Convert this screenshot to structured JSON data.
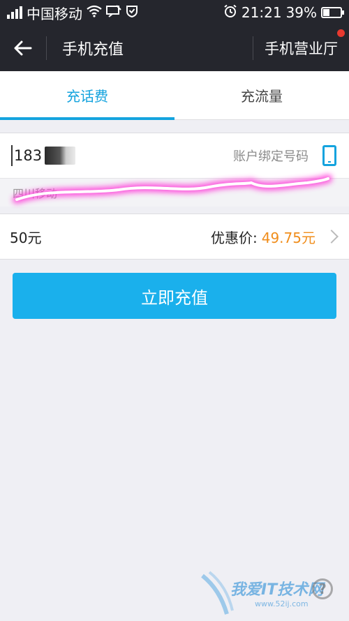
{
  "status_bar": {
    "carrier": "中国移动",
    "time": "21:21",
    "battery": "39%",
    "battery_level": 0.39
  },
  "nav": {
    "title": "手机充值",
    "right_link": "手机营业厅"
  },
  "tabs": [
    {
      "label": "充话费",
      "active": true
    },
    {
      "label": "充流量",
      "active": false
    }
  ],
  "phone": {
    "number_prefix": "183",
    "hint": "账户绑定号码",
    "operator": "四川移动"
  },
  "amount": {
    "value": "50元",
    "discount_label": "优惠价:",
    "discount_price": "49.75元"
  },
  "recharge_button": "立即充值",
  "watermark": {
    "text": "我爱IT技术网",
    "url": "www.52ij.com"
  },
  "colors": {
    "accent": "#14a3de",
    "button": "#1ab0ec",
    "price": "#f08d1b",
    "header": "#25262d",
    "badge": "#e8392f"
  }
}
